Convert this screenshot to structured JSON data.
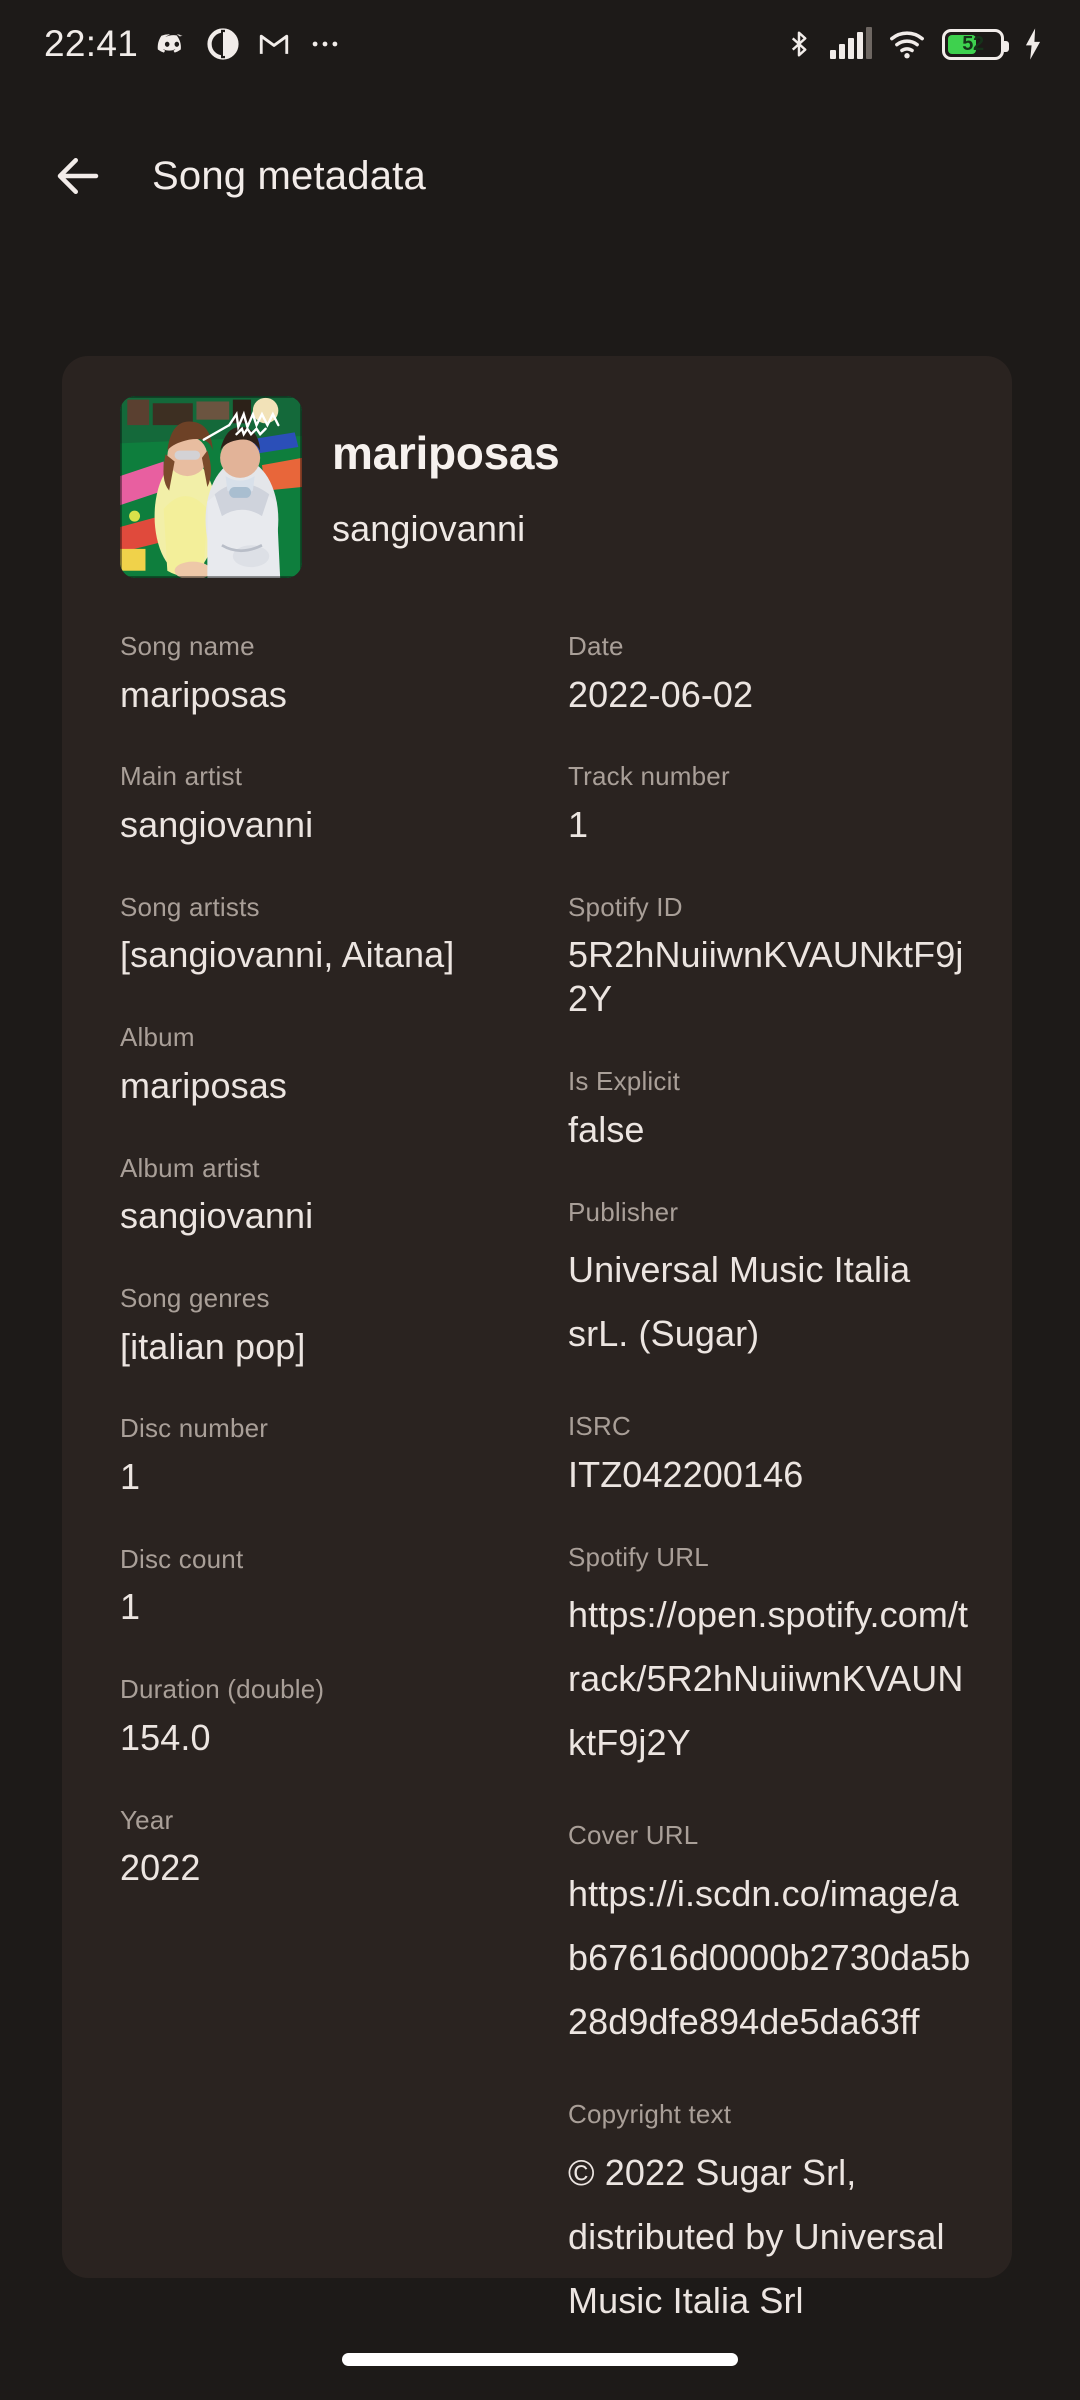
{
  "status_bar": {
    "time": "22:41",
    "left_icons": [
      "discord-icon",
      "circle-icon",
      "gmail-icon",
      "overflow-dots-icon"
    ],
    "right_icons": [
      "bluetooth-icon",
      "cellular-signal-icon",
      "wifi-icon",
      "battery-icon",
      "charging-bolt-icon"
    ],
    "battery_percent": "52",
    "battery_fill_color": "#3ed14e"
  },
  "app_bar": {
    "back_label": "back-arrow",
    "title": "Song metadata"
  },
  "song_header": {
    "title": "mariposas",
    "artist": "sangiovanni",
    "cover_alt": "mariposas album cover"
  },
  "fields_left": [
    {
      "label": "Song name",
      "value": "mariposas"
    },
    {
      "label": "Main artist",
      "value": "sangiovanni"
    },
    {
      "label": "Song artists",
      "value": "[sangiovanni, Aitana]"
    },
    {
      "label": "Album",
      "value": "mariposas"
    },
    {
      "label": "Album artist",
      "value": "sangiovanni"
    },
    {
      "label": "Song genres",
      "value": "[italian pop]"
    },
    {
      "label": "Disc number",
      "value": "1"
    },
    {
      "label": "Disc count",
      "value": "1"
    },
    {
      "label": "Duration (double)",
      "value": "154.0"
    },
    {
      "label": "Year",
      "value": "2022"
    }
  ],
  "fields_right": [
    {
      "label": "Date",
      "value": "2022-06-02"
    },
    {
      "label": "Track number",
      "value": "1"
    },
    {
      "label": "Spotify ID",
      "value": "5R2hNuiiwnKVAUNktF9j2Y"
    },
    {
      "label": "Is Explicit",
      "value": "false"
    },
    {
      "label": "Publisher",
      "value": "Universal Music Italia srL. (Sugar)"
    },
    {
      "label": "ISRC",
      "value": "ITZ042200146"
    },
    {
      "label": "Spotify URL",
      "value": "https://open.spotify.com/track/5R2hNuiiwnKVAUNktF9j2Y"
    },
    {
      "label": "Cover URL",
      "value": "https://i.scdn.co/image/ab67616d0000b2730da5b28d9dfe894de5da63ff"
    },
    {
      "label": "Copyright text",
      "value": "© 2022 Sugar Srl, distributed by Universal Music Italia Srl"
    }
  ],
  "colors": {
    "page_background": "#1d1a18",
    "card_background": "#2a2320",
    "label_text": "#a99f98",
    "value_text": "#ece5e1",
    "accent_white": "#f2ece9"
  },
  "gesture_bar": {
    "name": "home-indicator"
  }
}
